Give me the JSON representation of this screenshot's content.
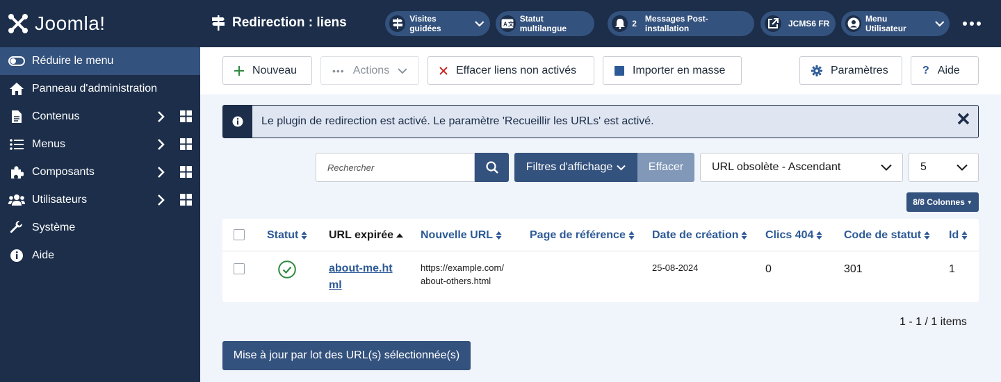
{
  "sidebar": {
    "logo_text": "Joomla!",
    "items": [
      {
        "label": "Réduire le menu",
        "icon": "toggle-icon"
      },
      {
        "label": "Panneau d'administration",
        "icon": "home-icon"
      },
      {
        "label": "Contenus",
        "icon": "file-icon"
      },
      {
        "label": "Menus",
        "icon": "list-icon"
      },
      {
        "label": "Composants",
        "icon": "puzzle-icon"
      },
      {
        "label": "Utilisateurs",
        "icon": "users-icon"
      },
      {
        "label": "Système",
        "icon": "wrench-icon"
      },
      {
        "label": "Aide",
        "icon": "info-icon"
      }
    ]
  },
  "header": {
    "title": "Redirection : liens",
    "pills": {
      "tours": "Visites guidées",
      "multilang": "Statut multilangue",
      "messages_count": "2",
      "messages": "Messages Post-installation",
      "site": "JCMS6 FR",
      "user_menu": "Menu Utilisateur"
    }
  },
  "toolbar": {
    "new": "Nouveau",
    "actions": "Actions",
    "purge": "Effacer liens non activés",
    "bulk_import": "Importer en masse",
    "options": "Paramètres",
    "help": "Aide"
  },
  "alert": {
    "text": "Le plugin de redirection est activé. Le paramètre 'Recueillir les URLs' est activé."
  },
  "filters": {
    "search_placeholder": "Rechercher",
    "filter_options": "Filtres d'affichage",
    "clear": "Effacer",
    "ordering": "URL obsolète - Ascendant",
    "limit": "5",
    "columns": "8/8 Colonnes"
  },
  "table": {
    "headers": {
      "status": "Statut",
      "old_url": "URL expirée",
      "new_url": "Nouvelle URL",
      "referer": "Page de référence",
      "created": "Date de création",
      "hits": "Clics 404",
      "status_code": "Code de statut",
      "id": "Id"
    },
    "rows": [
      {
        "status": "published",
        "old_url_line1": "about-me.ht",
        "old_url_line2": "ml",
        "new_url_line1": "https://example.com/",
        "new_url_line2": "about-others.html",
        "referer": "",
        "created": "25-08-2024",
        "hits": "0",
        "status_code": "301",
        "id": "1"
      }
    ]
  },
  "pagination": {
    "summary": "1 - 1 / 1 items"
  },
  "batch": {
    "label": "Mise à jour par lot des URL(s) sélectionnée(s)"
  },
  "colors": {
    "sidebar_bg": "#1c2e4a",
    "accent": "#34527e",
    "link": "#2d5a96",
    "success": "#2f8a3f"
  }
}
